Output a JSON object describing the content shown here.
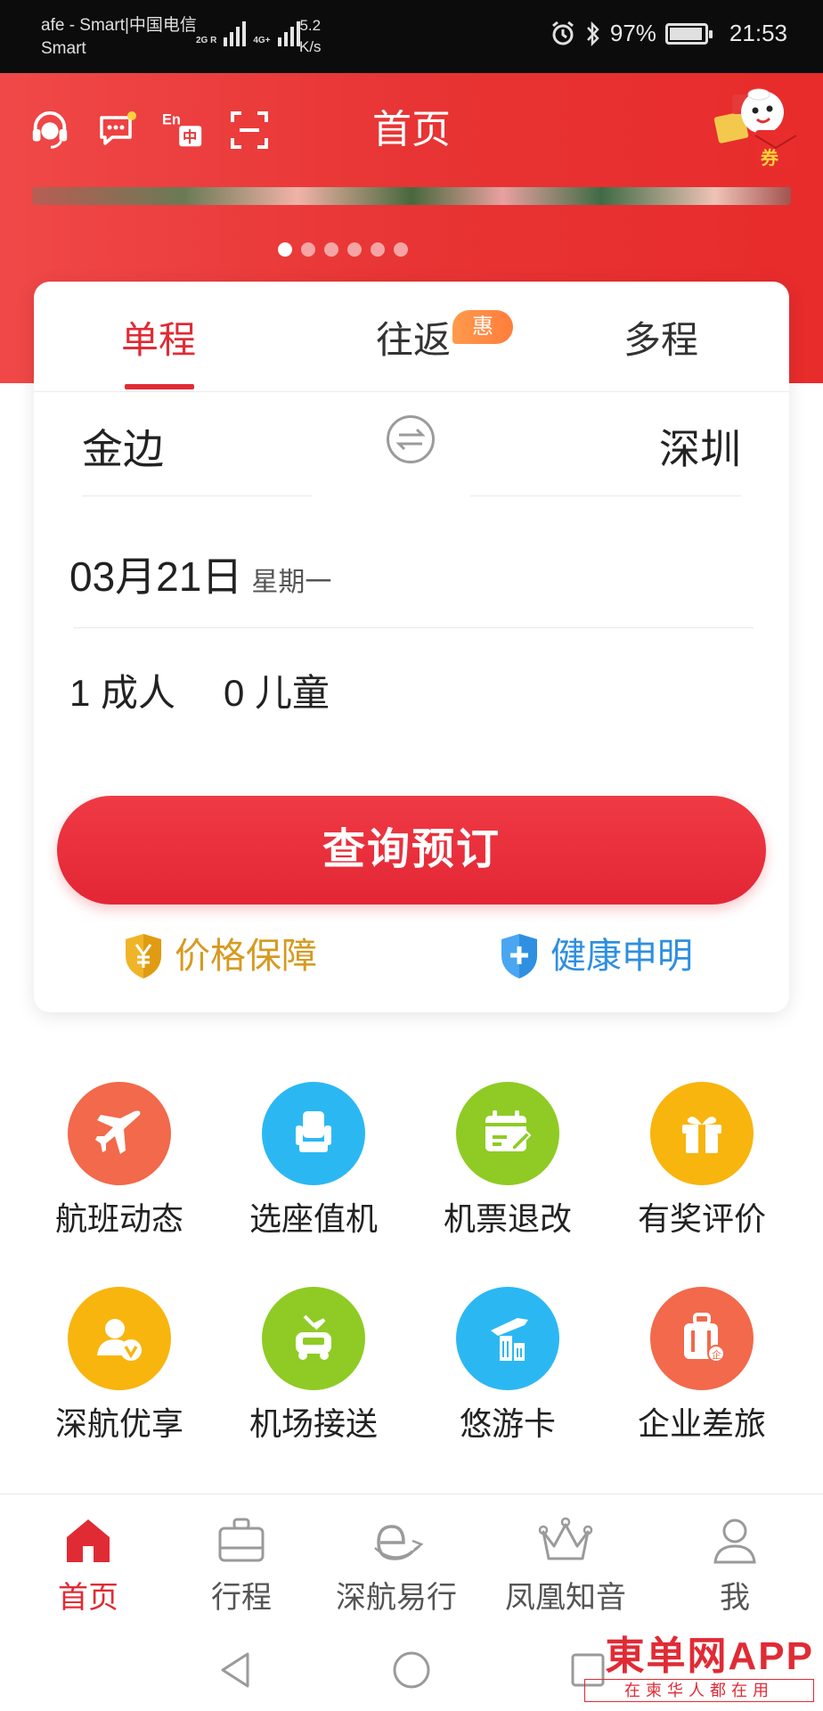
{
  "status_bar": {
    "carrier_line1": "afe - Smart|中国电信",
    "carrier_line2": "Smart",
    "net_2g": "2G R",
    "net_4g": "4G+",
    "speed_value": "5.2",
    "speed_unit": "K/s",
    "battery": "97%",
    "time": "21:53"
  },
  "header": {
    "title": "首页",
    "icons": [
      "customer-service-icon",
      "message-icon",
      "translate-icon",
      "scan-icon"
    ],
    "translate_en": "En",
    "translate_zh": "中",
    "promo_text": "券",
    "banner_pages": 6,
    "banner_active_index": 0
  },
  "booking": {
    "tabs": [
      {
        "label": "单程",
        "active": true
      },
      {
        "label": "往返",
        "active": false,
        "badge": "惠"
      },
      {
        "label": "多程",
        "active": false
      }
    ],
    "from_city": "金边",
    "to_city": "深圳",
    "date": "03月21日",
    "weekday": "星期一",
    "adults": "1 成人",
    "children": "0 儿童",
    "search_button": "查询预订",
    "price_guarantee": "价格保障",
    "health_declaration": "健康申明"
  },
  "services": [
    {
      "label": "航班动态",
      "icon": "plane-icon",
      "color": "#f2694b"
    },
    {
      "label": "选座值机",
      "icon": "seat-icon",
      "color": "#2bb8f2"
    },
    {
      "label": "机票退改",
      "icon": "calendar-edit-icon",
      "color": "#8fcb24"
    },
    {
      "label": "有奖评价",
      "icon": "gift-icon",
      "color": "#f8b50e"
    },
    {
      "label": "深航优享",
      "icon": "vip-user-icon",
      "color": "#f8b50e"
    },
    {
      "label": "机场接送",
      "icon": "car-icon",
      "color": "#8fcb24"
    },
    {
      "label": "悠游卡",
      "icon": "city-plane-icon",
      "color": "#2bb8f2"
    },
    {
      "label": "企业差旅",
      "icon": "luggage-icon",
      "color": "#f2694b"
    }
  ],
  "bottom_nav": [
    {
      "label": "首页",
      "icon": "home-icon",
      "active": true
    },
    {
      "label": "行程",
      "icon": "suitcase-icon",
      "active": false
    },
    {
      "label": "深航易行",
      "icon": "e-travel-icon",
      "active": false
    },
    {
      "label": "凤凰知音",
      "icon": "crown-icon",
      "active": false
    },
    {
      "label": "我",
      "icon": "user-icon",
      "active": false
    }
  ],
  "watermark": {
    "main": "東单网APP",
    "sub": "在柬华人都在用"
  },
  "colors": {
    "brand_red": "#e02b35",
    "gold": "#d79a21",
    "blue": "#2f8fe0"
  }
}
